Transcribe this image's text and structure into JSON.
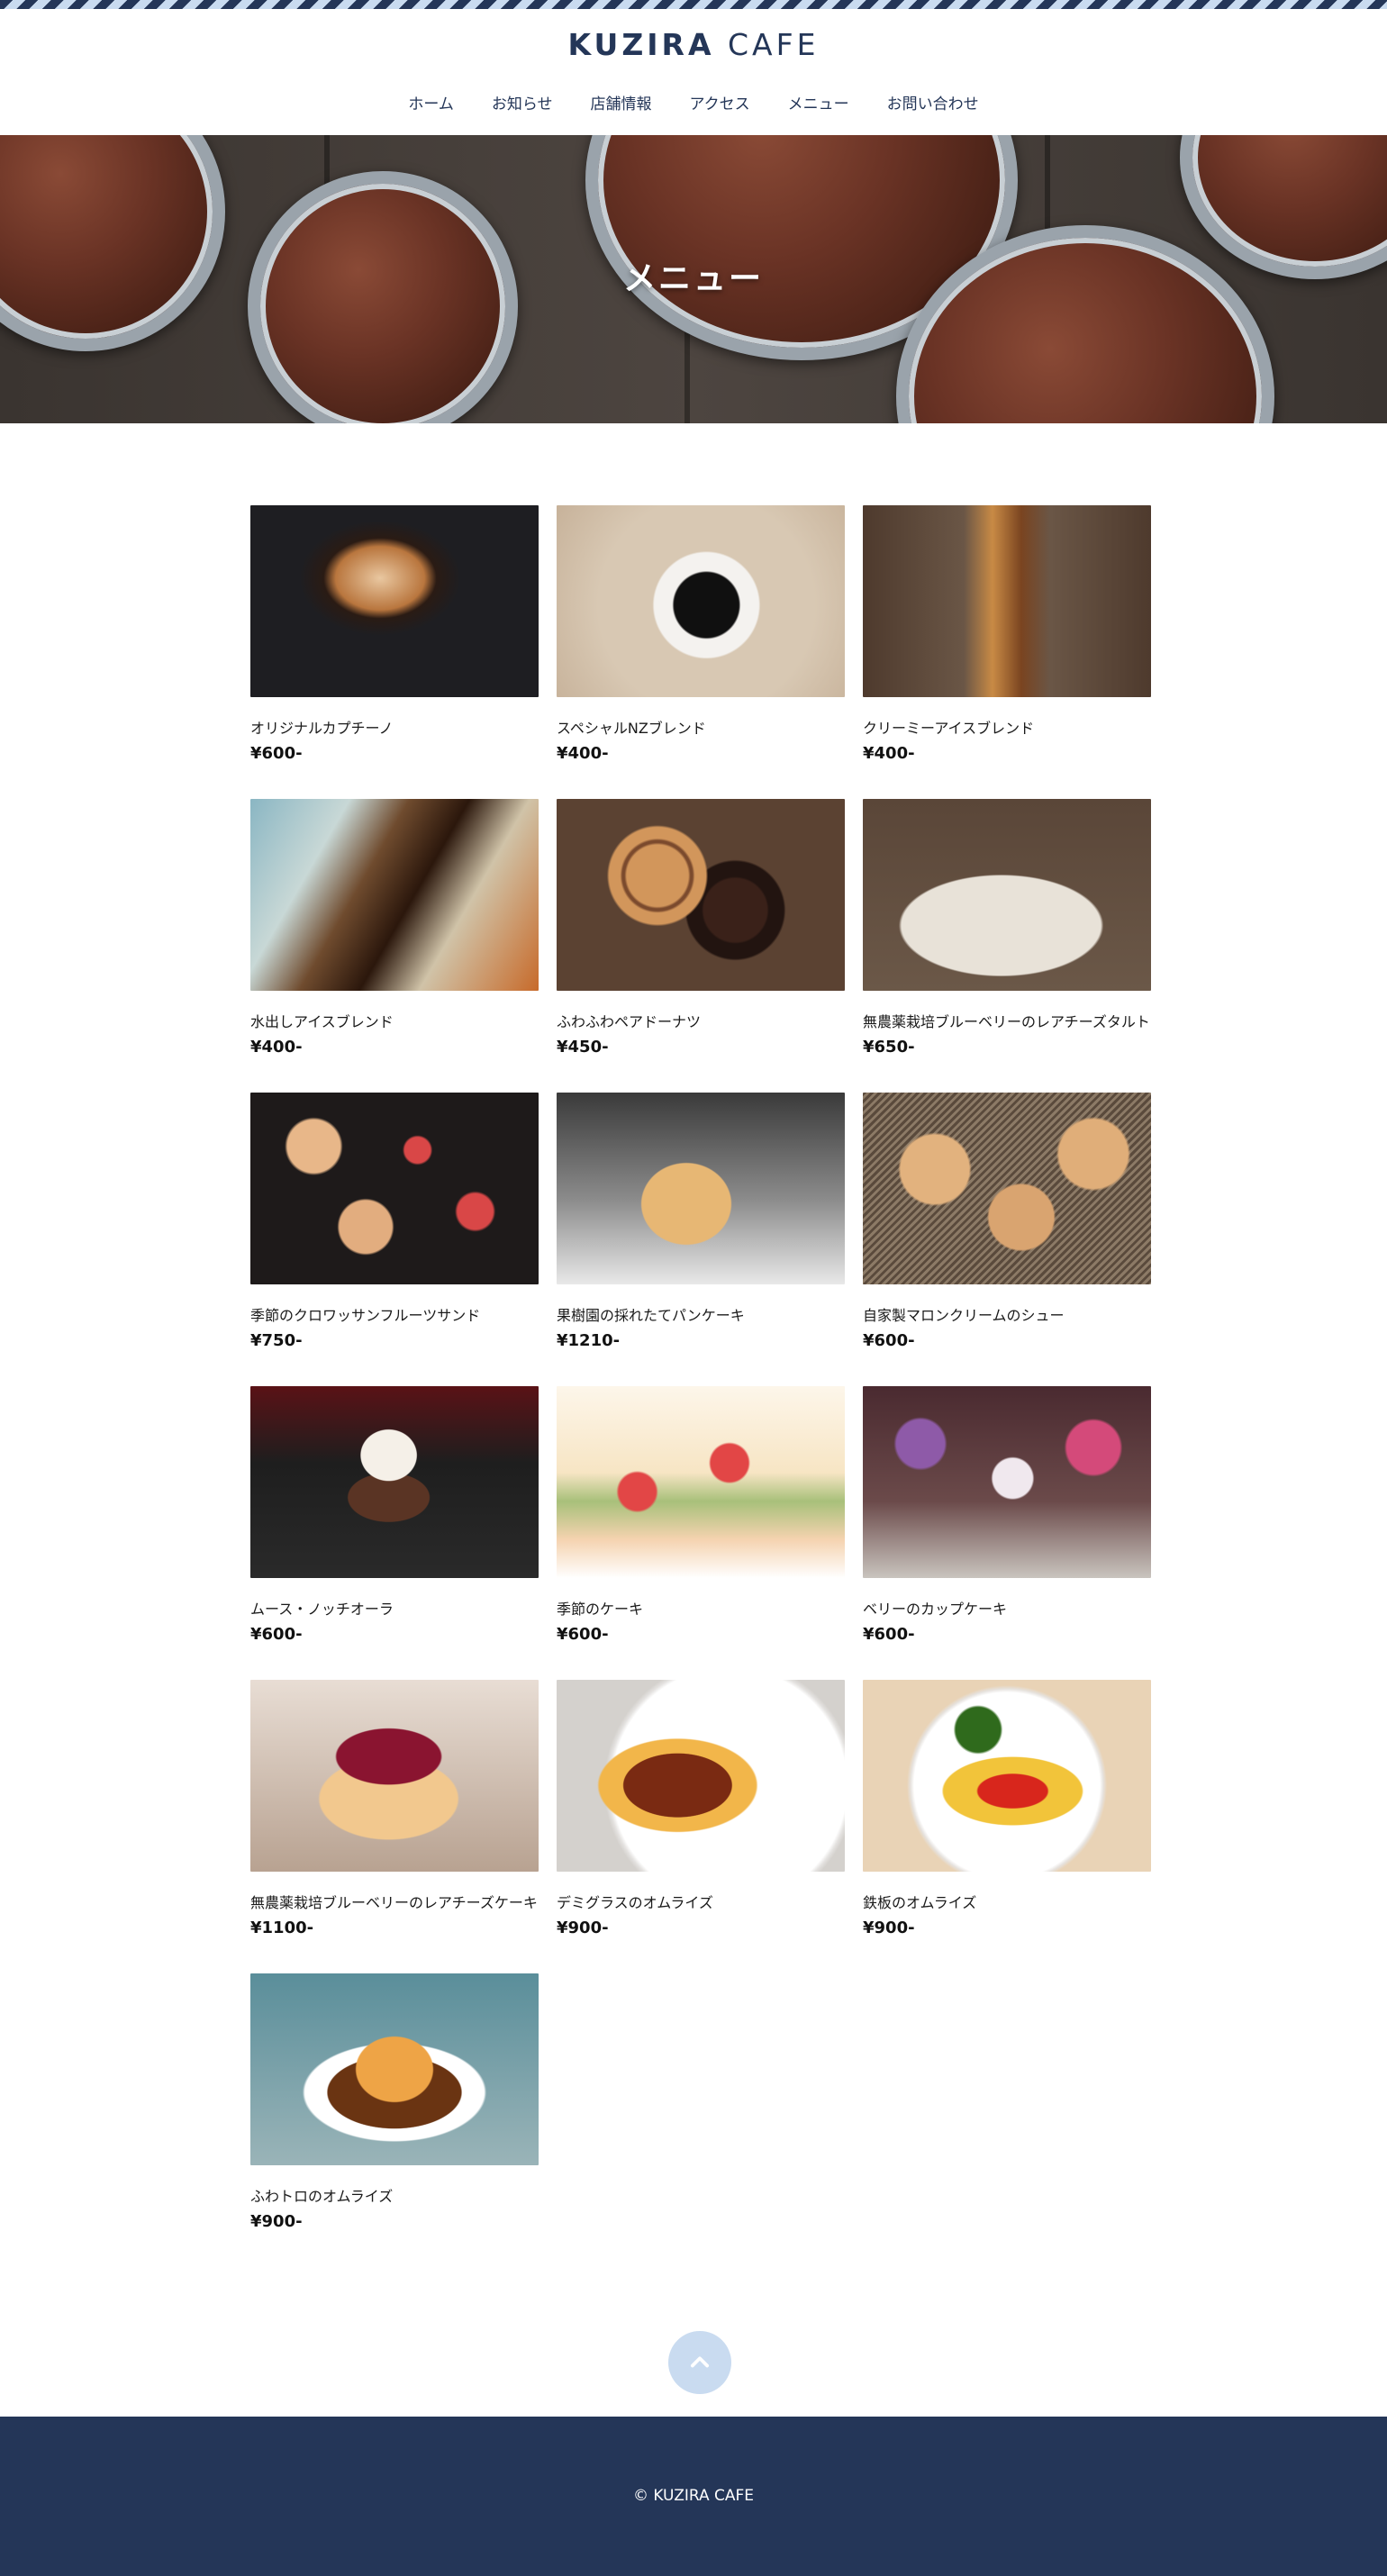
{
  "header": {
    "logo_bold": "KUZIRA",
    "logo_light": "CAFE",
    "nav": [
      "ホーム",
      "お知らせ",
      "店舗情報",
      "アクセス",
      "メニュー",
      "お問い合わせ"
    ]
  },
  "hero": {
    "title": "メニュー",
    "image": "chocolate-muffins-photo"
  },
  "menu": {
    "items": [
      {
        "name": "オリジナルカプチーノ",
        "price": "¥600-",
        "image": "cappuccino-photo"
      },
      {
        "name": "スペシャルNZブレンド",
        "price": "¥400-",
        "image": "hot-coffee-photo"
      },
      {
        "name": "クリーミーアイスブレンド",
        "price": "¥400-",
        "image": "iced-latte-photo"
      },
      {
        "name": "水出しアイスブレンド",
        "price": "¥400-",
        "image": "cold-brew-photo"
      },
      {
        "name": "ふわふわペアドーナツ",
        "price": "¥450-",
        "image": "donuts-photo"
      },
      {
        "name": "無農薬栽培ブルーベリーのレアチーズタルト",
        "price": "¥650-",
        "image": "blueberry-tart-photo"
      },
      {
        "name": "季節のクロワッサンフルーツサンド",
        "price": "¥750-",
        "image": "croissant-sandwich-photo"
      },
      {
        "name": "果樹園の採れたてパンケーキ",
        "price": "¥1210-",
        "image": "pancake-photo"
      },
      {
        "name": "自家製マロンクリームのシュー",
        "price": "¥600-",
        "image": "cream-puff-photo"
      },
      {
        "name": "ムース・ノッチオーラ",
        "price": "¥600-",
        "image": "chocolate-mousse-photo"
      },
      {
        "name": "季節のケーキ",
        "price": "¥600-",
        "image": "seasonal-cakes-photo"
      },
      {
        "name": "ベリーのカップケーキ",
        "price": "¥600-",
        "image": "berry-cupcakes-photo"
      },
      {
        "name": "無農薬栽培ブルーベリーのレアチーズケーキ",
        "price": "¥1100-",
        "image": "berry-cheesecake-photo"
      },
      {
        "name": "デミグラスのオムライズ",
        "price": "¥900-",
        "image": "demiglace-omurice-photo"
      },
      {
        "name": "鉄板のオムライズ",
        "price": "¥900-",
        "image": "ketchup-omurice-photo"
      },
      {
        "name": "ふわトロのオムライズ",
        "price": "¥900-",
        "image": "fluffy-omurice-photo"
      }
    ]
  },
  "back_to_top": {
    "icon": "chevron-up-icon"
  },
  "footer": {
    "copyright": "© KUZIRA CAFE"
  },
  "colors": {
    "navy": "#243658",
    "light_blue": "#c9dbf0"
  }
}
